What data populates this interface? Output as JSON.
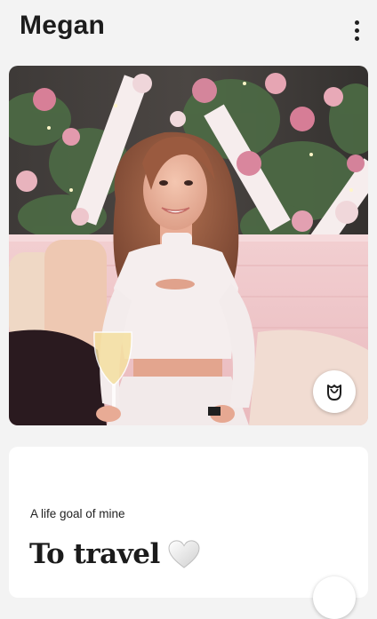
{
  "profile": {
    "name": "Megan"
  },
  "header": {
    "more_icon": "more-vertical-icon"
  },
  "photo": {
    "description_icon": "photo",
    "rose_icon": "rose-icon"
  },
  "prompt": {
    "question": "A life goal of mine",
    "answer": "To travel",
    "emoji_icon": "white-heart-icon",
    "like_icon": "heart-icon"
  },
  "colors": {
    "background": "#f3f3f3",
    "card": "#ffffff",
    "text": "#1a1a1a"
  }
}
